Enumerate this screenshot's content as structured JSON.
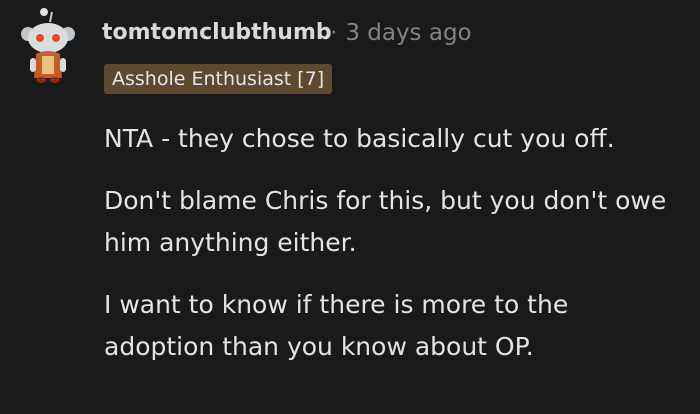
{
  "comment": {
    "username": "tomtomclubthumb",
    "separator": "·",
    "timestamp": "3 days ago",
    "flair": "Asshole Enthusiast [7]",
    "paragraphs": [
      "NTA - they chose to basically cut you off.",
      "Don't blame Chris for this, but you don't owe him anything either.",
      "I want to know if there is more to the adoption than you know about OP."
    ]
  },
  "colors": {
    "background": "#1a1a1b",
    "flair_bg": "#5c4a2e",
    "username": "#d7dadc",
    "meta": "#818384",
    "text": "#e4e4e4"
  },
  "icons": {
    "avatar": "snoo-avatar-icon"
  }
}
